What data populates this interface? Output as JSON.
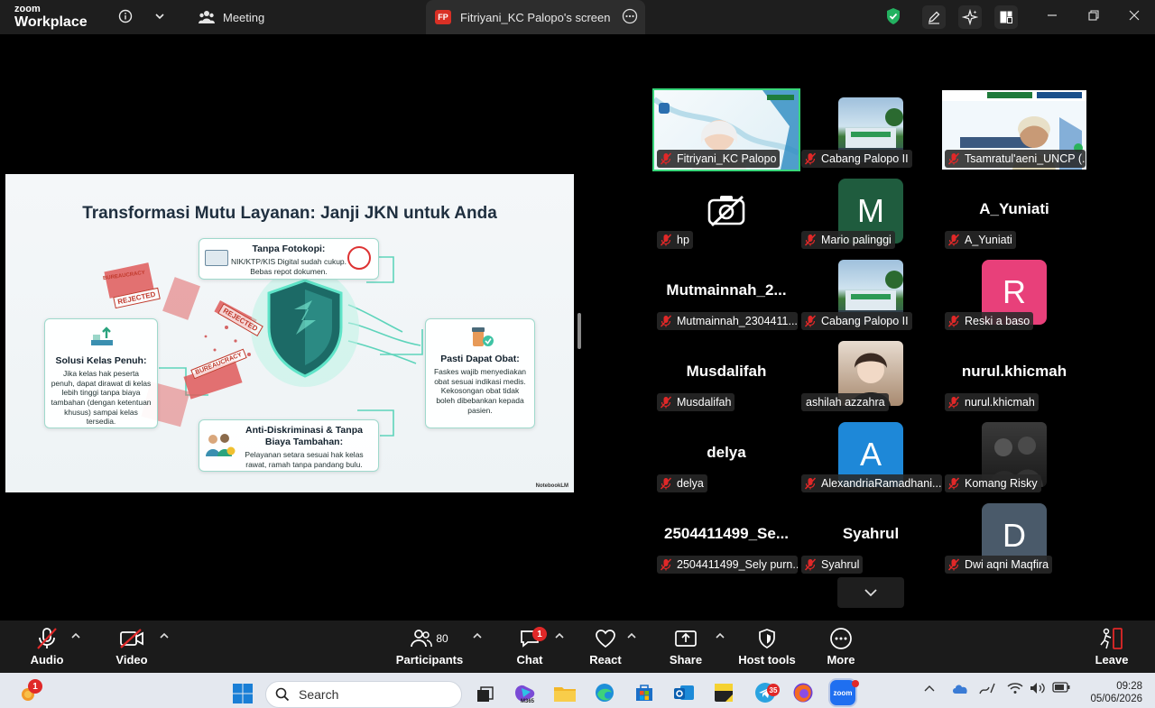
{
  "app": {
    "brand_top": "zoom",
    "brand_bottom": "Workplace"
  },
  "tabs": [
    {
      "label": "Meeting",
      "icon": "participants-icon"
    },
    {
      "label": "Fitriyani_KC Palopo's screen",
      "badge": "FP"
    }
  ],
  "slide": {
    "title": "Transformasi Mutu Layanan: Janji JKN untuk Anda",
    "cards": {
      "fotokopi": {
        "title": "Tanpa Fotokopi:",
        "body": "NIK/KTP/KIS Digital sudah cukup. Bebas repot dokumen."
      },
      "kelas": {
        "title": "Solusi Kelas Penuh:",
        "body": "Jika kelas hak peserta penuh, dapat dirawat di kelas lebih tinggi tanpa biaya tambahan (dengan ketentuan khusus) sampai kelas tersedia."
      },
      "obat": {
        "title": "Pasti Dapat Obat:",
        "body": "Faskes wajib menyediakan obat sesuai indikasi medis. Kekosongan obat tidak boleh dibebankan kepada pasien."
      },
      "diskriminasi": {
        "title": "Anti-Diskriminasi & Tanpa Biaya Tambahan:",
        "body": "Pelayanan setara sesuai hak kelas rawat, ramah tanpa pandang bulu."
      }
    },
    "stamps": [
      "REJECTED",
      "REJECTED",
      "BUREAUCRACY",
      "BUREAUCRACY"
    ],
    "watermark": "NotebookLM"
  },
  "participants": [
    {
      "label": "Fitriyani_KC Palopo",
      "kind": "video"
    },
    {
      "label": "Cabang Palopo II",
      "kind": "video"
    },
    {
      "label": "Tsamratul'aeni_UNCP (...",
      "kind": "video"
    },
    {
      "label": "hp",
      "kind": "camera-off"
    },
    {
      "label": "Mario palinggi",
      "kind": "avatar",
      "letter": "M",
      "color": "#1f5c3e"
    },
    {
      "label": "A_Yuniati",
      "kind": "name",
      "bigname": "A_Yuniati"
    },
    {
      "label": "Mutmainnah_2304411...",
      "kind": "name",
      "bigname": "Mutmainnah_2..."
    },
    {
      "label": "Cabang Palopo II",
      "kind": "video"
    },
    {
      "label": "Reski a baso",
      "kind": "avatar",
      "letter": "R",
      "color": "#e8407a"
    },
    {
      "label": "Musdalifah",
      "kind": "name",
      "bigname": "Musdalifah"
    },
    {
      "label": "ashilah azzahra",
      "kind": "photo"
    },
    {
      "label": "nurul.khicmah",
      "kind": "name",
      "bigname": "nurul.khicmah"
    },
    {
      "label": "delya",
      "kind": "name",
      "bigname": "delya"
    },
    {
      "label": "AlexandriaRamadhani...",
      "kind": "avatar",
      "letter": "A",
      "color": "#1e88d8"
    },
    {
      "label": "Komang Risky",
      "kind": "photo"
    },
    {
      "label": "2504411499_Sely purn...",
      "kind": "name",
      "bigname": "2504411499_Se..."
    },
    {
      "label": "Syahrul",
      "kind": "name",
      "bigname": "Syahrul"
    },
    {
      "label": "Dwi aqni Maqfira",
      "kind": "avatar",
      "letter": "D",
      "color": "#4a5a6a"
    }
  ],
  "toolbar": {
    "audio": "Audio",
    "video": "Video",
    "participants": "Participants",
    "participants_count": "80",
    "chat": "Chat",
    "chat_badge": "1",
    "react": "React",
    "share": "Share",
    "host_tools": "Host tools",
    "more": "More",
    "leave": "Leave"
  },
  "taskbar": {
    "weather_badge": "1",
    "search_placeholder": "Search",
    "m365": "M365",
    "telegram_badge": "35",
    "zoom": "zoom",
    "time": "09:28",
    "date": "05/06/2026"
  },
  "colors": {
    "accent_green": "#38d67a",
    "leave_red": "#e02828",
    "toolbar_bg": "#1b1b1b"
  }
}
